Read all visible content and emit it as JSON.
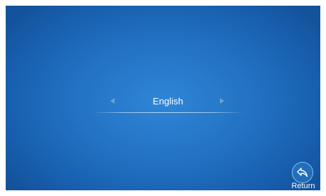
{
  "language": {
    "value": "English",
    "prev_icon": "triangle-left-icon",
    "next_icon": "triangle-right-icon"
  },
  "return_button": {
    "label": "Return",
    "icon": "return-arrow-icon"
  },
  "colors": {
    "background_center": "#2f86d6",
    "background_edge": "#14539c",
    "arrow": "#6ea3cf",
    "text": "#ffffff",
    "return_ring": "#7fc0f0"
  }
}
